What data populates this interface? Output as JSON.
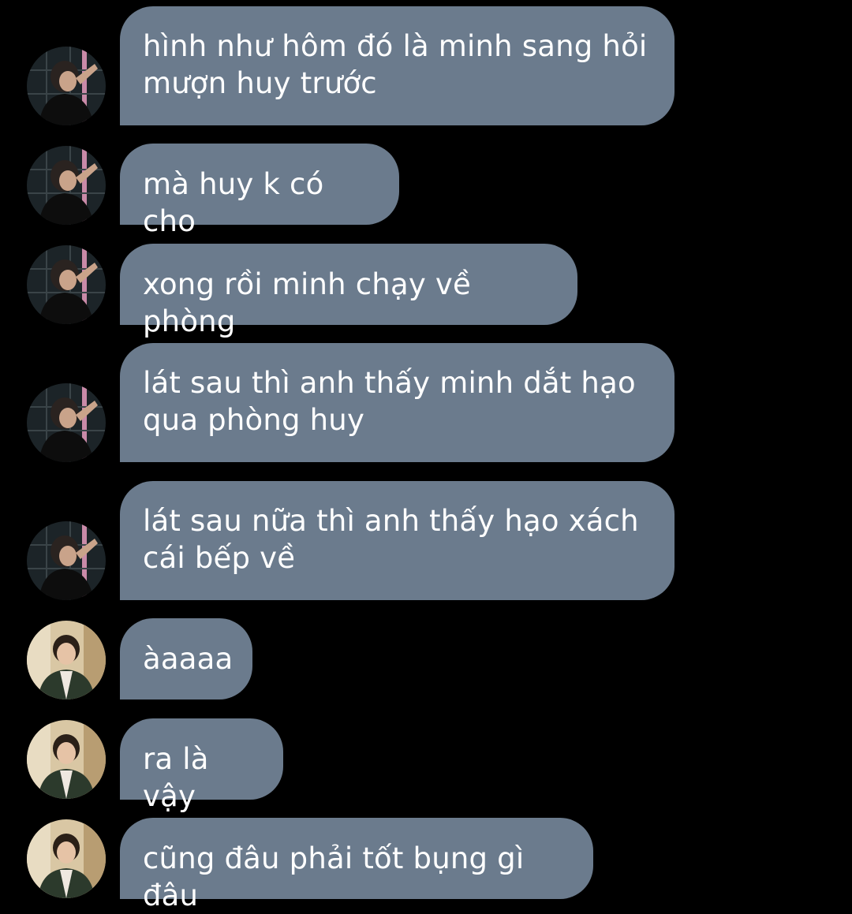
{
  "colors": {
    "background": "#000000",
    "bubble": "#6b7b8d",
    "text": "#ffffff"
  },
  "messages": [
    {
      "sender": "user-a",
      "avatar_icon": "profile-photo-icon",
      "text": "hình như hôm đó là minh sang hỏi\nmượn huy trước"
    },
    {
      "sender": "user-a",
      "avatar_icon": "profile-photo-icon",
      "text": "mà huy k có cho"
    },
    {
      "sender": "user-a",
      "avatar_icon": "profile-photo-icon",
      "text": "xong rồi minh chạy về phòng"
    },
    {
      "sender": "user-a",
      "avatar_icon": "profile-photo-icon",
      "text": "lát sau thì anh thấy minh dắt hạo\nqua phòng huy"
    },
    {
      "sender": "user-a",
      "avatar_icon": "profile-photo-icon",
      "text": "lát sau nữa thì anh thấy hạo xách\ncái bếp về"
    },
    {
      "sender": "user-b",
      "avatar_icon": "profile-photo-icon",
      "text": "àaaaa"
    },
    {
      "sender": "user-b",
      "avatar_icon": "profile-photo-icon",
      "text": "ra là vậy"
    },
    {
      "sender": "user-b",
      "avatar_icon": "profile-photo-icon",
      "text": "cũng đâu phải tốt bụng gì đâu"
    }
  ]
}
